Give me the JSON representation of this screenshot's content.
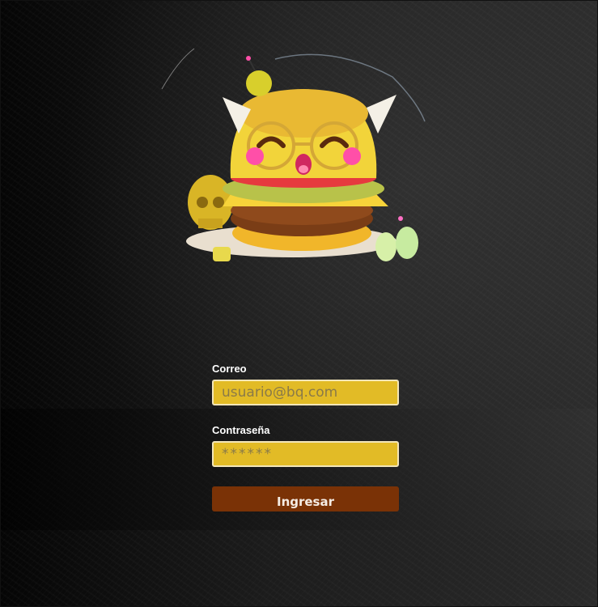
{
  "logo": {
    "alt": "burger mascot logo"
  },
  "form": {
    "email": {
      "label": "Correo",
      "placeholder": "usuario@bq.com",
      "value": ""
    },
    "password": {
      "label": "Contraseña",
      "placeholder": "******",
      "value": ""
    },
    "submit_label": "Ingresar"
  },
  "colors": {
    "input_bg": "#e2bb26",
    "input_border": "#f3e6b8",
    "button_bg": "#7a3206",
    "label_text": "#ffffff"
  }
}
